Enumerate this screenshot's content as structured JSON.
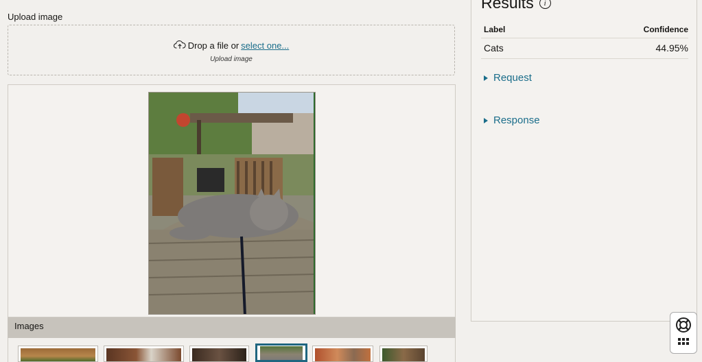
{
  "upload": {
    "label": "Upload image",
    "drop_text": "Drop a file or",
    "select_link": "select one...",
    "caption": "Upload image"
  },
  "images_panel": {
    "label": "Images",
    "selected_index": 3,
    "thumbnail_count": 6
  },
  "results": {
    "title": "Results",
    "columns": [
      "Label",
      "Confidence"
    ],
    "rows": [
      {
        "label": "Cats",
        "confidence": "44.95%"
      }
    ],
    "request_label": "Request",
    "response_label": "Response"
  },
  "icons": {
    "upload": "cloud-upload-icon",
    "info": "info-icon",
    "disclosure": "triangle-right-icon",
    "help": "lifebuoy-icon",
    "apps": "grid-icon"
  },
  "colors": {
    "link": "#1a6d8a",
    "selected_thumb_border": "#1f6680",
    "images_bar": "#c7c3bc"
  }
}
